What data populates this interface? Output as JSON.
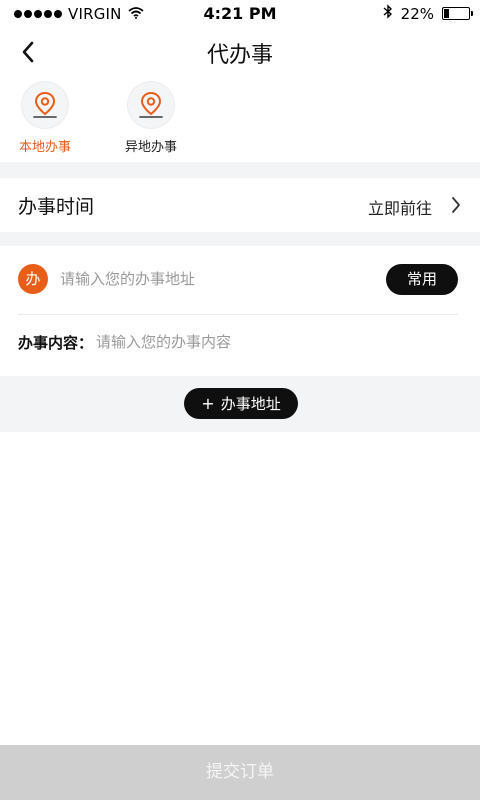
{
  "status_bar": {
    "carrier": "VIRGIN",
    "time": "4:21 PM",
    "battery": "22%",
    "battery_level": 0.22
  },
  "nav": {
    "title": "代办事",
    "back_icon": "chevron-left-icon"
  },
  "tabs": [
    {
      "label": "本地办事",
      "icon": "location-pin-icon",
      "active": true
    },
    {
      "label": "异地办事",
      "icon": "location-pin-icon",
      "active": false
    }
  ],
  "time_row": {
    "title": "办事时间",
    "value": "立即前往"
  },
  "address": {
    "badge": "办",
    "placeholder": "请输入您的办事地址",
    "value": "",
    "common_label": "常用",
    "content_label": "办事内容：",
    "content_placeholder": "请输入您的办事内容"
  },
  "add_address": {
    "plus": "+",
    "label": "办事地址"
  },
  "submit": {
    "label": "提交订单"
  },
  "colors": {
    "accent": "#e85d18",
    "dark_button": "#0f0f0f",
    "section_gap": "#f3f4f6",
    "submit_disabled": "#cfcfcf"
  }
}
